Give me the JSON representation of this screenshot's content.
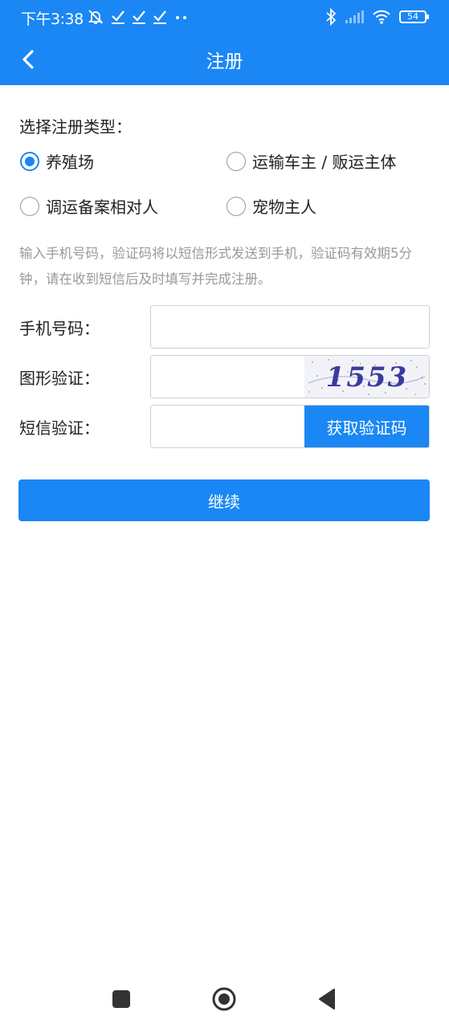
{
  "status_bar": {
    "time": "下午3:38",
    "battery": "54",
    "left_icons": [
      "mute-bell-icon",
      "check-icon",
      "check-icon",
      "check-icon",
      "more-dots-icon"
    ],
    "right_icons": [
      "bluetooth-icon",
      "signal-icon",
      "wifi-icon",
      "battery-icon"
    ]
  },
  "app_bar": {
    "title": "注册",
    "back_icon": "chevron-left-icon"
  },
  "register_type": {
    "label": "选择注册类型：",
    "options": [
      {
        "label": "养殖场",
        "checked": true
      },
      {
        "label": "运输车主 / 贩运主体",
        "checked": false
      },
      {
        "label": "调运备案相对人",
        "checked": false
      },
      {
        "label": "宠物主人",
        "checked": false
      }
    ]
  },
  "notice": "输入手机号码，验证码将以短信形式发送到手机，验证码有效期5分钟，请在收到短信后及时填写并完成注册。",
  "form": {
    "phone_label": "手机号码：",
    "phone_value": "",
    "captcha_label": "图形验证：",
    "captcha_value": "",
    "captcha_image_text": "1553",
    "sms_label": "短信验证：",
    "sms_value": "",
    "get_code_button": "获取验证码"
  },
  "continue_button": "继续",
  "colors": {
    "primary": "#1a87f5",
    "notice_text": "#999999",
    "border": "#cfcfcf"
  },
  "nav_bar": [
    "square-recent-icon",
    "circle-home-icon",
    "triangle-back-icon"
  ]
}
